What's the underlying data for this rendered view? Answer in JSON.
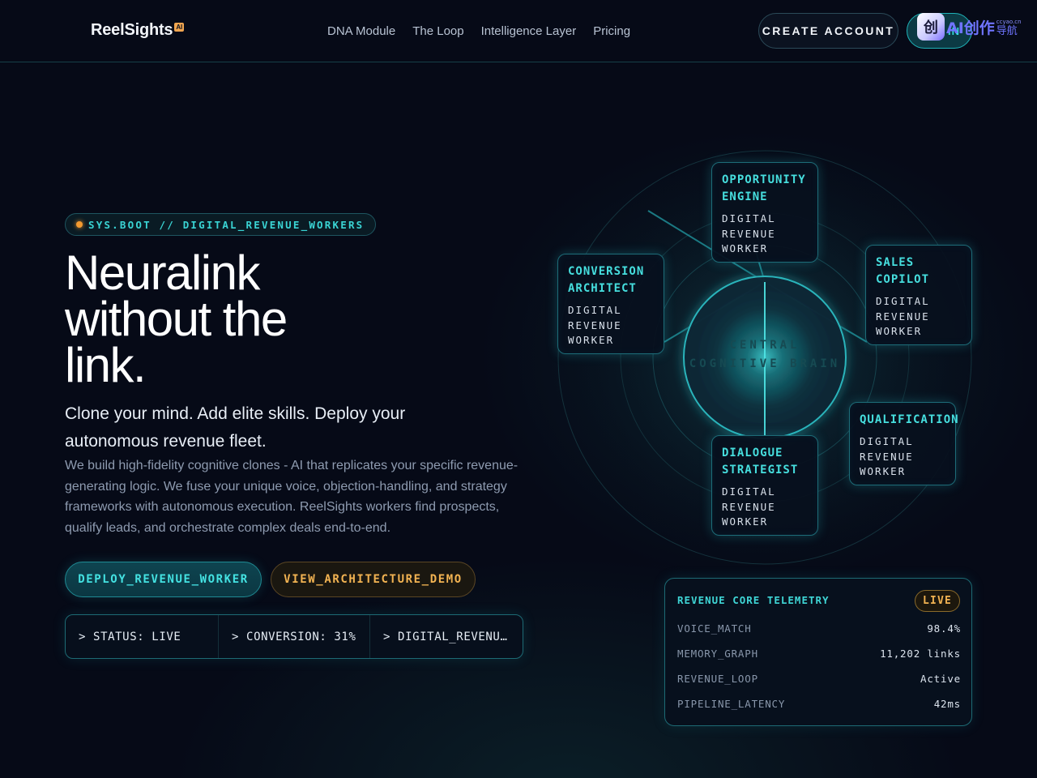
{
  "nav": {
    "logo": "ReelSights",
    "logo_badge": "AI",
    "links": [
      "DNA Module",
      "The Loop",
      "Intelligence Layer",
      "Pricing"
    ],
    "create_account": "CREATE ACCOUNT",
    "login": "IN",
    "watermark": {
      "icon": "创",
      "text": "AI创作",
      "sub_top": "ccyao.cn",
      "sub": "导航"
    }
  },
  "hero": {
    "badge": "SYS.BOOT // DIGITAL_REVENUE_WORKERS",
    "title_lines": [
      "Neuralink",
      "without the",
      "link."
    ],
    "subtitle": "Clone your mind. Add elite skills. Deploy your autonomous revenue fleet.",
    "description": "We build high-fidelity cognitive clones - AI that replicates your specific revenue-generating logic. We fuse your unique voice, objection-handling, and strategy frameworks with autonomous execution. ReelSights workers find prospects, qualify leads, and orchestrate complex deals end-to-end.",
    "cta_primary": "DEPLOY_REVENUE_WORKER",
    "cta_secondary": "VIEW_ARCHITECTURE_DEMO",
    "status": [
      "> STATUS: LIVE",
      "> CONVERSION: 31%",
      "> DIGITAL_REVENU…"
    ]
  },
  "diagram": {
    "core_lines": [
      "CENTRAL",
      "COGNITIVE BRAIN"
    ],
    "nodes": [
      {
        "title": [
          "OPPORTUNITY",
          "ENGINE"
        ],
        "sub": [
          "DIGITAL",
          "REVENUE",
          "WORKER"
        ]
      },
      {
        "title": [
          "CONVERSION",
          "ARCHITECT"
        ],
        "sub": [
          "DIGITAL",
          "REVENUE",
          "WORKER"
        ]
      },
      {
        "title": [
          "SALES",
          "COPILOT"
        ],
        "sub": [
          "DIGITAL",
          "REVENUE",
          "WORKER"
        ]
      },
      {
        "title": [
          "QUALIFICATION"
        ],
        "sub": [
          "DIGITAL",
          "REVENUE",
          "WORKER"
        ]
      },
      {
        "title": [
          "DIALOGUE",
          "STRATEGIST"
        ],
        "sub": [
          "DIGITAL",
          "REVENUE",
          "WORKER"
        ]
      }
    ]
  },
  "telemetry": {
    "title": "REVENUE CORE TELEMETRY",
    "badge": "LIVE",
    "rows": [
      {
        "key": "VOICE_MATCH",
        "value": "98.4%"
      },
      {
        "key": "MEMORY_GRAPH",
        "value": "11,202 links"
      },
      {
        "key": "REVENUE_LOOP",
        "value": "Active"
      },
      {
        "key": "PIPELINE_LATENCY",
        "value": "42ms"
      }
    ]
  },
  "colors": {
    "accent": "#3fd6d6",
    "warm": "#f2b352",
    "background": "#060a17"
  }
}
